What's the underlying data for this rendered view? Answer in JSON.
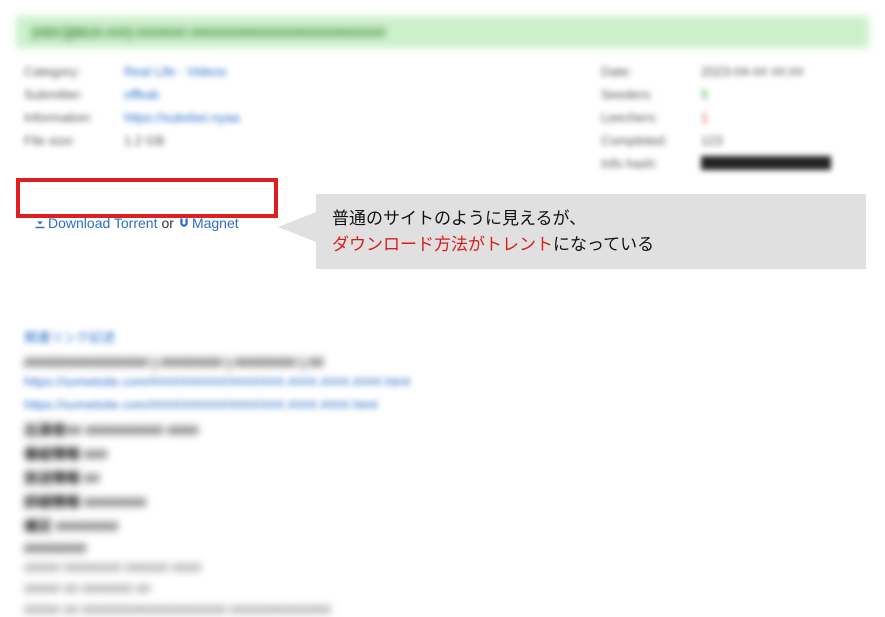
{
  "banner": {
    "text": "[HDC][MUX-###] ####### ###########################"
  },
  "details": {
    "left": {
      "r1_label": "Category:",
      "r1_value": "Real Life - Videos",
      "r2_label": "Submitter:",
      "r2_value": "offkab",
      "r3_label": "Information:",
      "r3_value": "https://sukebei.nyaa",
      "r4_label": "File size:",
      "r4_value": "1.2 GB"
    },
    "right": {
      "r1_label": "Date:",
      "r1_value": "2023-04-## ##:##",
      "r2_label": "Seeders:",
      "r2_value": "5",
      "r3_label": "Leechers:",
      "r3_value": "1",
      "r4_label": "Completed:",
      "r4_value": "123",
      "r5_label": "Info hash:",
      "r5_value": ""
    }
  },
  "download": {
    "torrent_label": "Download Torrent",
    "or_label": "or",
    "magnet_label": "Magnet"
  },
  "annotation": {
    "line1": "普通のサイトのように見えるが、",
    "highlight": "ダウンロード方法がトレント",
    "tail": "になっている"
  },
  "content": {
    "link1": "関連リンク記述",
    "line_a": "################ | ######## | ######## | ##",
    "url1": "https://sometsite.com/####/######/####/###.####.####.####.html",
    "url2": "https://sometsite.com/####/######/####/###.####.####.html",
    "d1": "出演者## ########## ####",
    "d2": "番組情報 ###",
    "d3": "放送情報 ##",
    "d4": "詳細情報 ########",
    "d5": "補足 ########",
    "d6": "########",
    "d7": "##### ######## ###### ####",
    "d8": "##### ## ####### ##",
    "d9": "##### ## #################### ##############"
  }
}
